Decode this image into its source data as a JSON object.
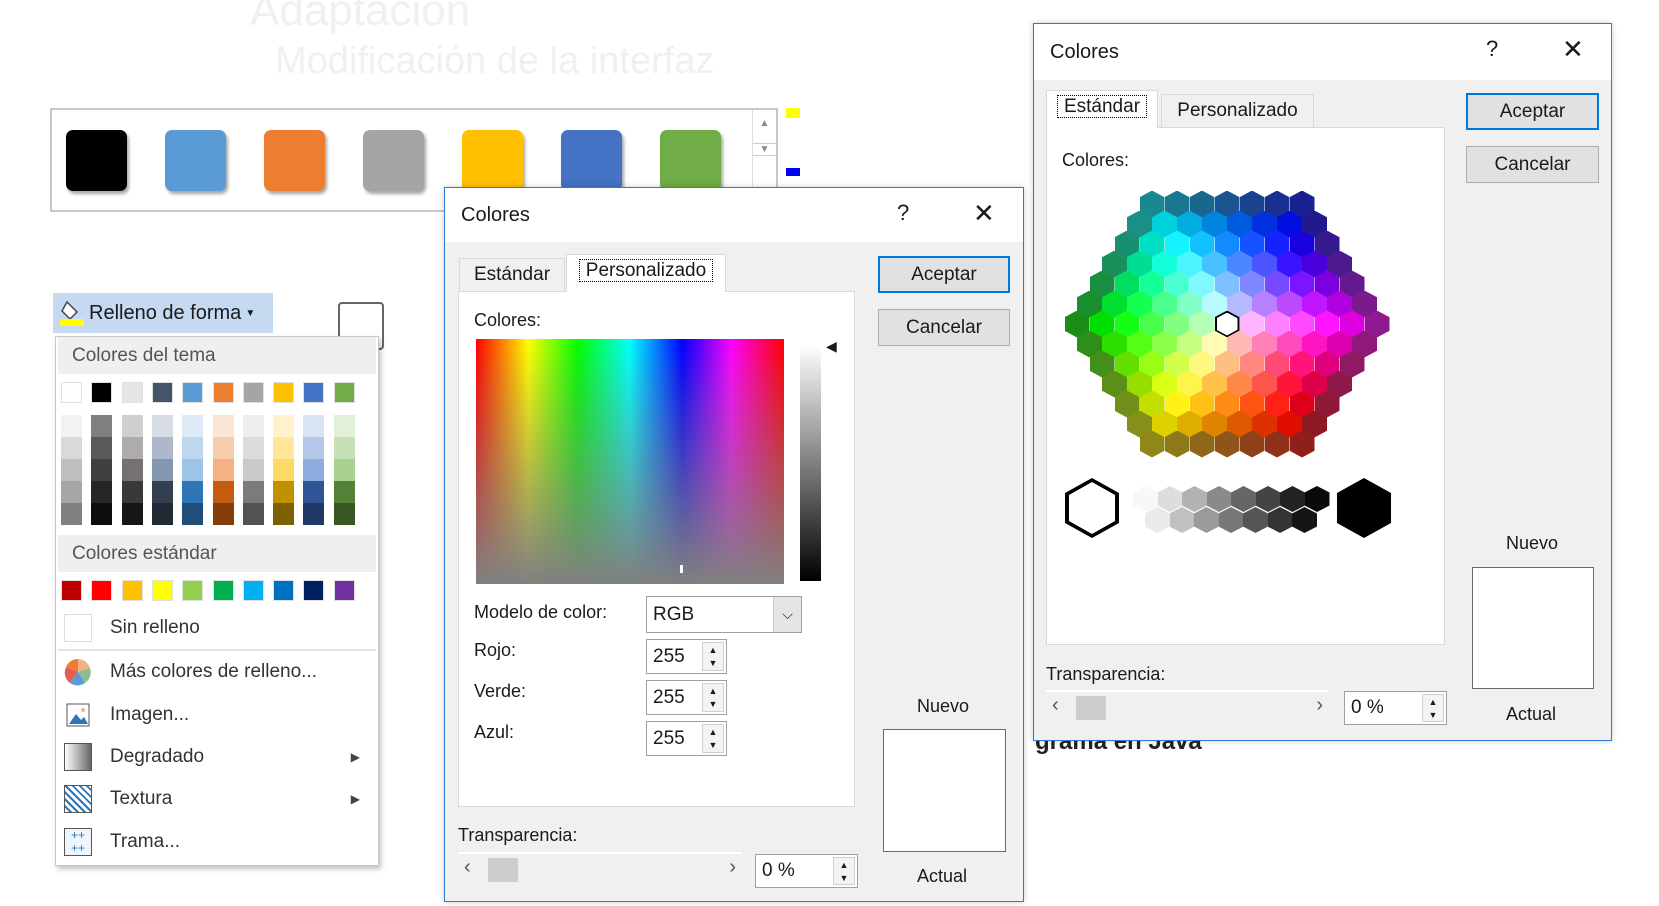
{
  "slide": {
    "heading": "Adaptación",
    "bullet": "Modificación de la interfaz",
    "behind_text": "grama en Java"
  },
  "gallery": {
    "swatches": [
      "#000000",
      "#5b9bd5",
      "#ed7d31",
      "#a5a5a5",
      "#ffc000",
      "#4472c4",
      "#70ad47"
    ]
  },
  "fill_button": {
    "label": "Relleno de forma",
    "fill_color": "#ffff00"
  },
  "menu": {
    "theme_header": "Colores del tema",
    "theme_colors": [
      "#ffffff",
      "#000000",
      "#e7e6e6",
      "#44546a",
      "#5b9bd5",
      "#ed7d31",
      "#a5a5a5",
      "#ffc000",
      "#4472c4",
      "#70ad47"
    ],
    "theme_shades": [
      [
        "#f2f2f2",
        "#d9d9d9",
        "#bfbfbf",
        "#a6a6a6",
        "#808080"
      ],
      [
        "#7f7f7f",
        "#595959",
        "#404040",
        "#262626",
        "#0d0d0d"
      ],
      [
        "#d0cece",
        "#aeabab",
        "#757171",
        "#3a3838",
        "#171616"
      ],
      [
        "#d6dce4",
        "#adb9ca",
        "#8497b0",
        "#333f4f",
        "#222a35"
      ],
      [
        "#deebf6",
        "#bdd7ee",
        "#9dc3e6",
        "#2e75b5",
        "#1f4e79"
      ],
      [
        "#fbe5d5",
        "#f8cbad",
        "#f4b183",
        "#c55a11",
        "#843c0b"
      ],
      [
        "#ededed",
        "#dbdbdb",
        "#c9c9c9",
        "#7b7b7b",
        "#525252"
      ],
      [
        "#fff2cc",
        "#ffe699",
        "#ffd966",
        "#bf9000",
        "#7f6000"
      ],
      [
        "#dae3f3",
        "#b4c7e7",
        "#8faadc",
        "#2f5597",
        "#203864"
      ],
      [
        "#e2f0d9",
        "#c5e0b4",
        "#a9d18e",
        "#538135",
        "#385723"
      ]
    ],
    "standard_header": "Colores estándar",
    "standard_colors": [
      "#c00000",
      "#ff0000",
      "#ffc000",
      "#ffff00",
      "#92d050",
      "#00b050",
      "#00b0f0",
      "#0070c0",
      "#002060",
      "#7030a0"
    ],
    "no_fill": "Sin relleno",
    "more_colors": "Más colores de relleno...",
    "picture": "Imagen...",
    "gradient": "Degradado",
    "texture": "Textura",
    "pattern": "Trama..."
  },
  "dialog_custom": {
    "title": "Colores",
    "help": "?",
    "close": "✕",
    "tabs": [
      "Estándar",
      "Personalizado"
    ],
    "active_tab": "Personalizado",
    "ok": "Aceptar",
    "cancel": "Cancelar",
    "colors_label": "Colores:",
    "model_label": "Modelo de color:",
    "model_value": "RGB",
    "red_label": "Rojo:",
    "red": "255",
    "green_label": "Verde:",
    "green": "255",
    "blue_label": "Azul:",
    "blue": "255",
    "new_label": "Nuevo",
    "current_label": "Actual",
    "transparency_label": "Transparencia:",
    "transparency": "0 %"
  },
  "dialog_standard": {
    "title": "Colores",
    "help": "?",
    "close": "✕",
    "tabs": [
      "Estándar",
      "Personalizado"
    ],
    "active_tab": "Estándar",
    "ok": "Aceptar",
    "cancel": "Cancelar",
    "colors_label": "Colores:",
    "new_label": "Nuevo",
    "current_label": "Actual",
    "transparency_label": "Transparencia:",
    "transparency": "0 %"
  }
}
